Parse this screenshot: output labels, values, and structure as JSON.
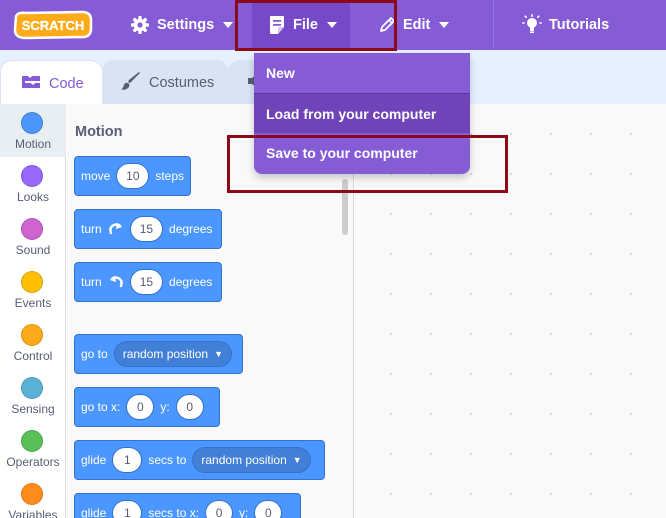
{
  "colors": {
    "menu_bg": "#855cd6",
    "block_blue": "#4c97ff",
    "highlight": "#8b0a1a"
  },
  "menubar": {
    "logo_text": "SCRATCH",
    "settings_label": "Settings",
    "file_label": "File",
    "edit_label": "Edit",
    "tutorials_label": "Tutorials"
  },
  "tabs": {
    "code_label": "Code",
    "costumes_label": "Costumes"
  },
  "categories": [
    {
      "label": "Motion",
      "color": "#4c97ff"
    },
    {
      "label": "Looks",
      "color": "#9966ff"
    },
    {
      "label": "Sound",
      "color": "#cf63cf"
    },
    {
      "label": "Events",
      "color": "#ffbf00"
    },
    {
      "label": "Control",
      "color": "#ffab19"
    },
    {
      "label": "Sensing",
      "color": "#5cb1d6"
    },
    {
      "label": "Operators",
      "color": "#59c059"
    },
    {
      "label": "Variables",
      "color": "#ff8c1a"
    }
  ],
  "flyout": {
    "title": "Motion",
    "blocks": {
      "move": {
        "pre": "move",
        "value": "10",
        "post": "steps"
      },
      "turn_right": {
        "pre": "turn",
        "value": "15",
        "post": "degrees"
      },
      "turn_left": {
        "pre": "turn",
        "value": "15",
        "post": "degrees"
      },
      "goto": {
        "pre": "go to",
        "menu": "random position"
      },
      "goto_xy": {
        "pre": "go to x:",
        "x": "0",
        "mid": "y:",
        "y": "0"
      },
      "glide": {
        "pre": "glide",
        "secs": "1",
        "mid": "secs to",
        "menu": "random position"
      },
      "glide_xy": {
        "pre": "glide",
        "secs": "1",
        "mid": "secs to x:",
        "x": "0",
        "ylabel": "y:",
        "y": "0"
      }
    }
  },
  "file_menu": {
    "items": [
      "New",
      "Load from your computer",
      "Save to your computer"
    ]
  }
}
